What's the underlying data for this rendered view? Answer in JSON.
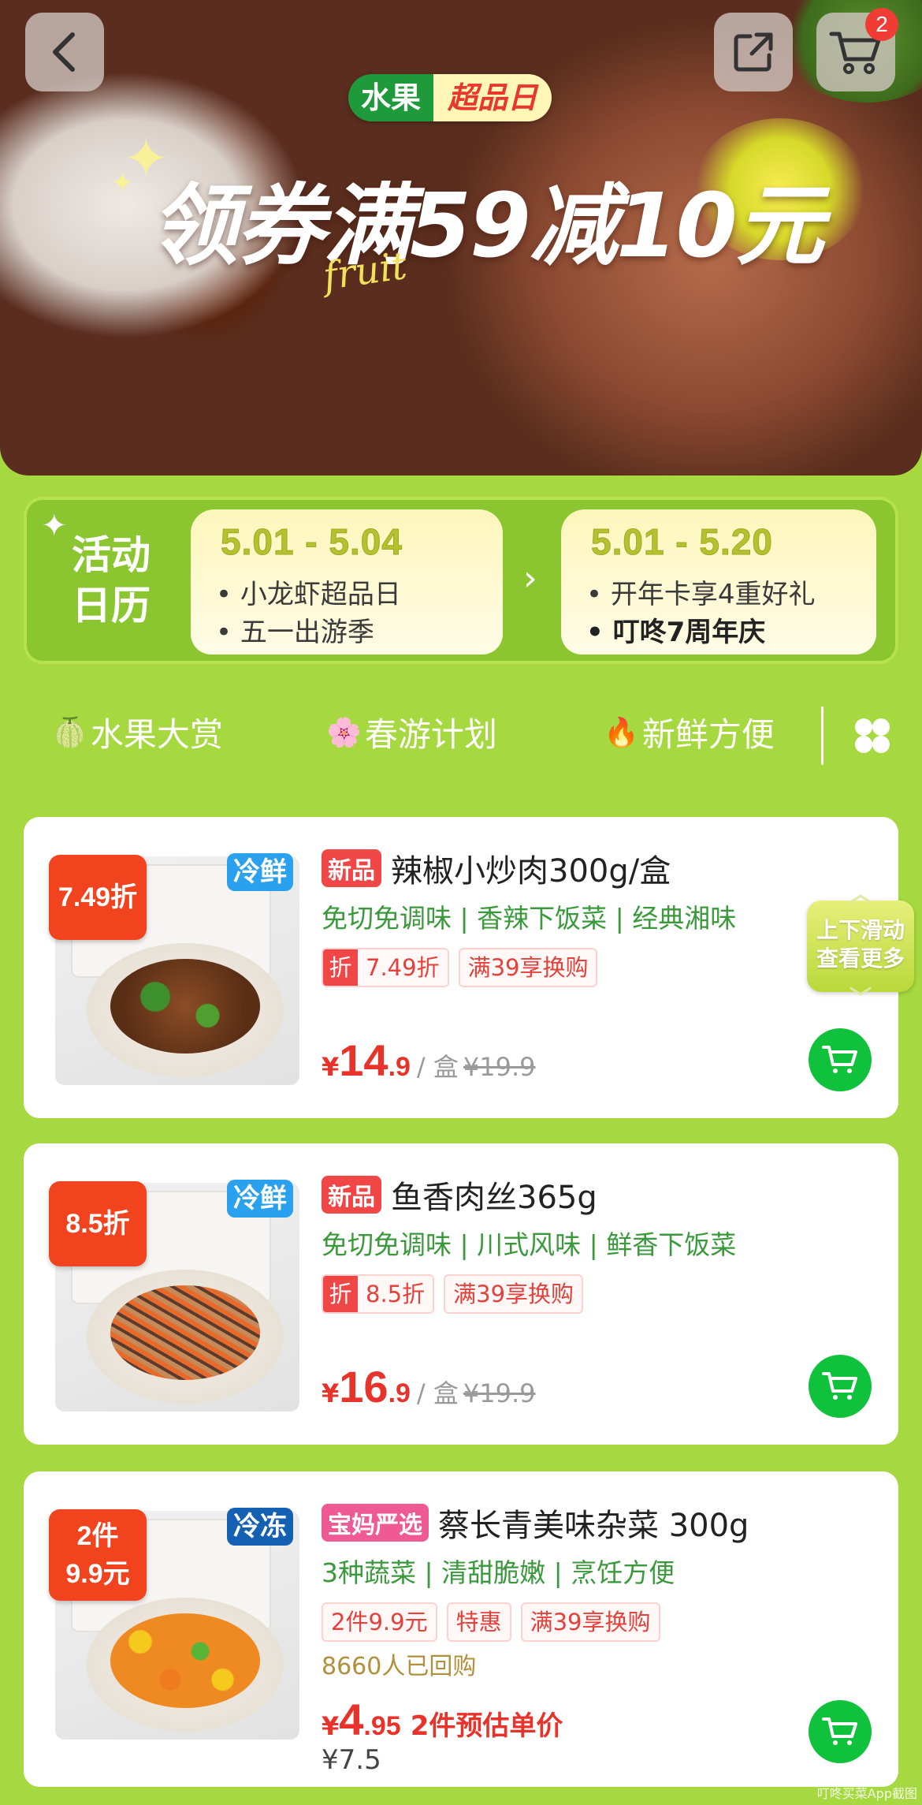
{
  "header": {
    "cart_count": "2",
    "pill_left": "水果",
    "pill_right": "超品日",
    "headline": "领券满59减10元",
    "headline_script": "fruit"
  },
  "calendar": {
    "title_line1": "活动",
    "title_line2": "日历",
    "cards": [
      {
        "date": "5.01 - 5.04",
        "line1": "• 小龙虾超品日",
        "line2": "• 五一出游季"
      },
      {
        "date": "5.01 - 5.20",
        "line1": "• 开年卡享4重好礼",
        "line2": "• 叮咚7周年庆"
      }
    ]
  },
  "tabs": [
    {
      "icon": "melon-icon",
      "emoji": "🍈",
      "label": "水果大赏"
    },
    {
      "icon": "blossom-icon",
      "emoji": "🌸",
      "label": "春游计划"
    },
    {
      "icon": "fire-icon",
      "emoji": "🔥",
      "label": "新鲜方便"
    }
  ],
  "scroll_hint": {
    "line1": "上下滑动",
    "line2": "查看更多"
  },
  "products": [
    {
      "discount_tag": "7.49折",
      "storage_tag": "冷鲜",
      "badge": "新品",
      "title": "辣椒小炒肉300g/盒",
      "features": "免切免调味 |  香辣下饭菜 |  经典湘味",
      "zhe_key": "折",
      "zhe_value": "7.49折",
      "chips": [
        "满39享换购"
      ],
      "price_currency": "¥",
      "price_int": "14",
      "price_dec": ".9",
      "unit": "/ 盒",
      "orig_price": "¥19.9"
    },
    {
      "discount_tag": "8.5折",
      "storage_tag": "冷鲜",
      "badge": "新品",
      "title": "鱼香肉丝365g",
      "features": "免切免调味 |  川式风味 |  鲜香下饭菜",
      "zhe_key": "折",
      "zhe_value": "8.5折",
      "chips": [
        "满39享换购"
      ],
      "price_currency": "¥",
      "price_int": "16",
      "price_dec": ".9",
      "unit": "/ 盒",
      "orig_price": "¥19.9"
    },
    {
      "discount_tag_line1": "2件",
      "discount_tag_line2": "9.9元",
      "storage_tag": "冷冻",
      "badge": "宝妈严选",
      "title": "蔡长青美味杂菜 300g",
      "features": "3种蔬菜 |  清甜脆嫩 |  烹饪方便",
      "chips": [
        "2件9.9元",
        "特惠",
        "满39享换购"
      ],
      "repurchase": "8660人已回购",
      "price_currency": "¥",
      "price_int": "4",
      "price_dec": ".95",
      "estimate_label": "2件预估单价",
      "orig_price": "¥7.5"
    }
  ],
  "watermark": "叮咚买菜App截图",
  "colors": {
    "page_bg": "#a6d93f",
    "price_red": "#e8332b",
    "feature_green": "#3a9a3b",
    "cart_green": "#10c13c"
  }
}
